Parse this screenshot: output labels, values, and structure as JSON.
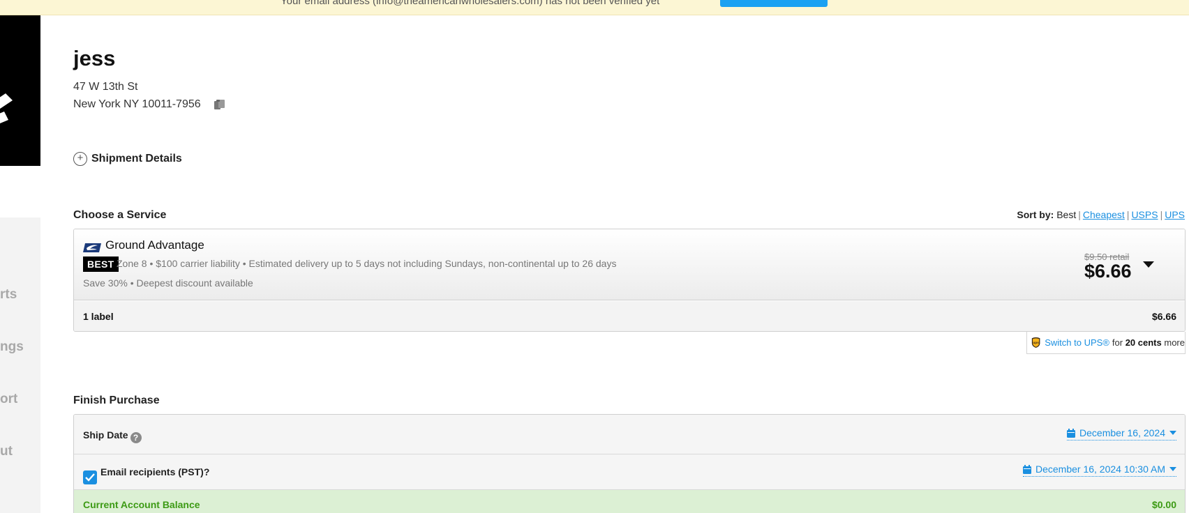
{
  "banner": {
    "text": "Your email address (info@theamericanwholesalers.com) has not been verified yet"
  },
  "sidebar": {
    "items": [
      {
        "label": "rts"
      },
      {
        "label": "ngs"
      },
      {
        "label": "ort"
      },
      {
        "label": "ut"
      }
    ]
  },
  "recipient": {
    "name": "jess",
    "address_line1": "47 W 13th St",
    "address_line2": "New York NY 10011-7956"
  },
  "shipment_details": {
    "label": "Shipment Details"
  },
  "choose_service": {
    "title": "Choose a Service",
    "sort": {
      "label": "Sort by:",
      "current": "Best",
      "options": [
        "Cheapest",
        "USPS",
        "UPS"
      ]
    },
    "service": {
      "name": "Ground Advantage",
      "badge": "BEST",
      "description": "Zone 8 • $100 carrier liability • Estimated delivery up to 5 days not including Sundays, non-continental up to 26 days",
      "savings": "Save 30% • Deepest discount available",
      "retail_price": "$9.50 retail",
      "price": "$6.66",
      "label_count": "1 label",
      "label_total": "$6.66"
    },
    "ups_switch": {
      "link": "Switch to UPS®",
      "for": "for",
      "amount": "20 cents",
      "more": "more"
    }
  },
  "finish_purchase": {
    "title": "Finish Purchase",
    "ship_date_label": "Ship Date",
    "ship_date_value": "December 16, 2024",
    "email_label": "Email recipients (PST)?",
    "email_checked": true,
    "email_date_value": "December 16, 2024 10:30 AM",
    "balance_label": "Current Account Balance",
    "balance_value": "$0.00"
  },
  "colors": {
    "accent": "#1a8fe0",
    "banner_bg": "#fcf6d4",
    "balance_bg": "#dcf0d4",
    "balance_text": "#3c9a14"
  }
}
